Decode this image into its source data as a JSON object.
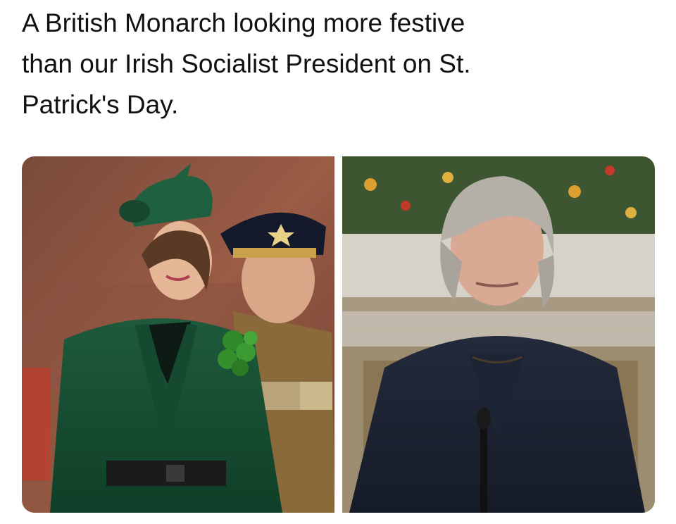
{
  "post": {
    "text_line_1": "A British Monarch looking more festive",
    "text_line_2": "than our Irish Socialist President on St.",
    "text_line_3": "Patrick's Day."
  },
  "media": {
    "count": 2
  }
}
